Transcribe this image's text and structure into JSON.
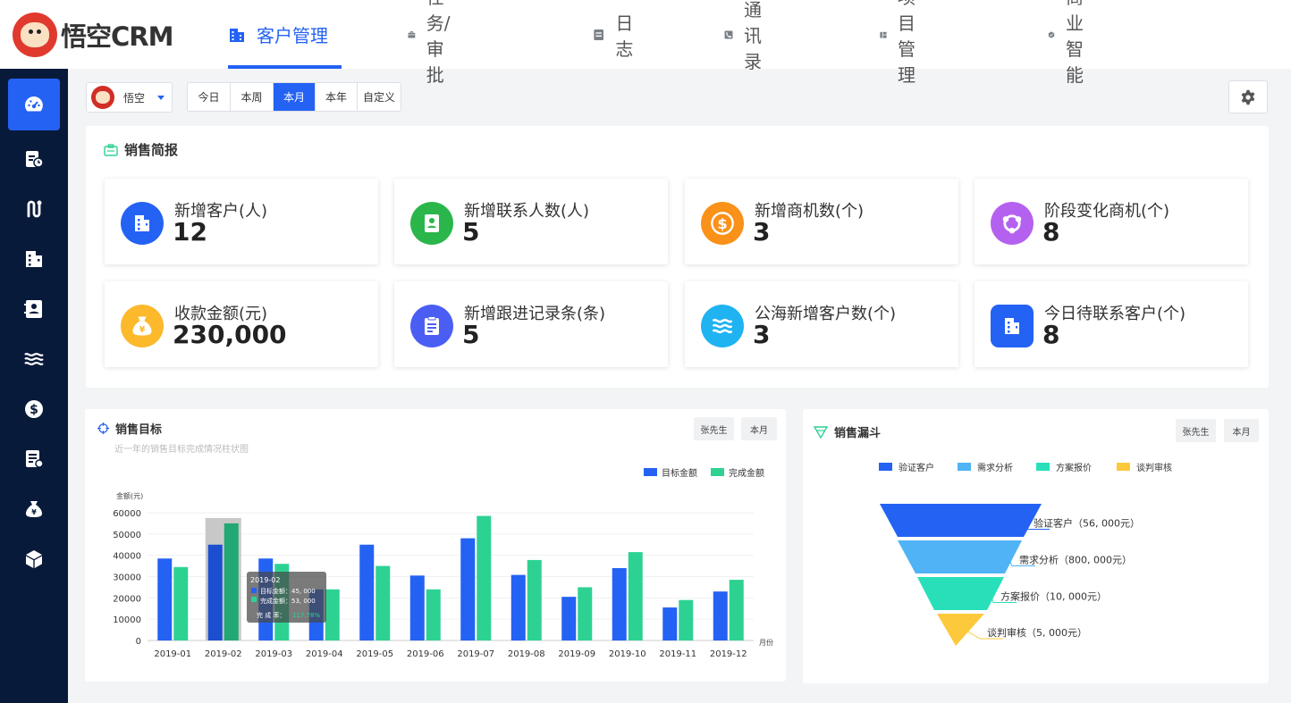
{
  "app": {
    "logo_text": "悟空CRM"
  },
  "nav": {
    "items": [
      {
        "label": "客户管理",
        "icon": "building-icon",
        "active": true
      },
      {
        "label": "任务/审批",
        "icon": "briefcase-icon",
        "active": false
      },
      {
        "label": "日志",
        "icon": "document-icon",
        "active": false
      },
      {
        "label": "通讯录",
        "icon": "phone-book-icon",
        "active": false
      },
      {
        "label": "项目管理",
        "icon": "project-board-icon",
        "active": false
      },
      {
        "label": "商业智能",
        "icon": "shield-check-icon",
        "active": false
      }
    ]
  },
  "sidebar": {
    "items": [
      {
        "icon": "dashboard-icon",
        "active": true
      },
      {
        "icon": "clipboard-clock-icon",
        "active": false
      },
      {
        "icon": "route-icon",
        "active": false
      },
      {
        "icon": "building-icon",
        "active": false
      },
      {
        "icon": "contact-card-icon",
        "active": false
      },
      {
        "icon": "waves-icon",
        "active": false
      },
      {
        "icon": "dollar-coin-icon",
        "active": false
      },
      {
        "icon": "contract-icon",
        "active": false
      },
      {
        "icon": "money-bag-icon",
        "active": false
      },
      {
        "icon": "cube-icon",
        "active": false
      }
    ]
  },
  "filter": {
    "user_name": "悟空",
    "periods": [
      "今日",
      "本周",
      "本月",
      "本年",
      "自定义"
    ],
    "active_period": "本月"
  },
  "brief": {
    "title": "销售简报",
    "stats": [
      {
        "label": "新增客户(人)",
        "value": "12",
        "icon": "building-icon",
        "color": "#2462f4"
      },
      {
        "label": "新增联系人数(人)",
        "value": "5",
        "icon": "contact-card-icon",
        "color": "#2ab64a"
      },
      {
        "label": "新增商机数(个)",
        "value": "3",
        "icon": "dollar-coin-icon",
        "color": "#fa9119"
      },
      {
        "label": "阶段变化商机(个)",
        "value": "8",
        "icon": "cycle-icon",
        "color": "#b561ef"
      },
      {
        "label": "收款金额(元)",
        "value": "230,000",
        "icon": "money-bag-icon",
        "color": "#fbb92b"
      },
      {
        "label": "新增跟进记录条(条)",
        "value": "5",
        "icon": "clipboard-icon",
        "color": "#4a5ef4"
      },
      {
        "label": "公海新增客户数(个)",
        "value": "3",
        "icon": "waves-icon",
        "color": "#1fb3f2"
      },
      {
        "label": "今日待联系客户(个)",
        "value": "8",
        "icon": "building-icon",
        "color": "#2462f4"
      }
    ]
  },
  "sales_target": {
    "title": "销售目标",
    "subtitle": "近一年的销售目标完成情况柱状图",
    "chips": [
      "张先生",
      "本月"
    ],
    "tooltip": {
      "title": "2019-02",
      "target_label": "目标金额：45, 000",
      "done_label": "完成金额：53, 000",
      "rate_label": "完 成 率：",
      "rate_value": "117.78%"
    }
  },
  "sales_funnel": {
    "title": "销售漏斗",
    "chips": [
      "张先生",
      "本月"
    ],
    "legend": [
      "验证客户",
      "需求分析",
      "方案报价",
      "谈判审核"
    ],
    "labels": [
      "验证客户（56, 000元）",
      "需求分析（800, 000元）",
      "方案报价（10, 000元）",
      "谈判审核（5, 000元）"
    ],
    "colors": [
      "#2462f4",
      "#4fb3f6",
      "#29dfb9",
      "#fbc93b"
    ]
  },
  "chart_data": [
    {
      "type": "bar",
      "title": "销售目标",
      "ylabel": "金额(元)",
      "xlabel": "月份",
      "categories": [
        "2019-01",
        "2019-02",
        "2019-03",
        "2019-04",
        "2019-05",
        "2019-06",
        "2019-07",
        "2019-08",
        "2019-09",
        "2019-10",
        "2019-11",
        "2019-12"
      ],
      "series": [
        {
          "name": "目标金额",
          "color": "#2462f4",
          "values": [
            38500,
            45000,
            38500,
            24000,
            45000,
            30500,
            48000,
            30800,
            20500,
            34000,
            15500,
            23000
          ]
        },
        {
          "name": "完成金额",
          "color": "#2dd293",
          "values": [
            34500,
            55000,
            36000,
            24000,
            35000,
            24000,
            58500,
            37800,
            25000,
            41500,
            19000,
            28500
          ]
        }
      ],
      "yticks": [
        0,
        10000,
        20000,
        30000,
        40000,
        50000,
        60000
      ],
      "ylim": [
        0,
        60000
      ],
      "legend_position": "top-right",
      "grid": true
    },
    {
      "type": "funnel",
      "title": "销售漏斗",
      "categories": [
        "验证客户",
        "需求分析",
        "方案报价",
        "谈判审核"
      ],
      "values": [
        56000,
        800000,
        10000,
        5000
      ],
      "legend_position": "top"
    }
  ]
}
